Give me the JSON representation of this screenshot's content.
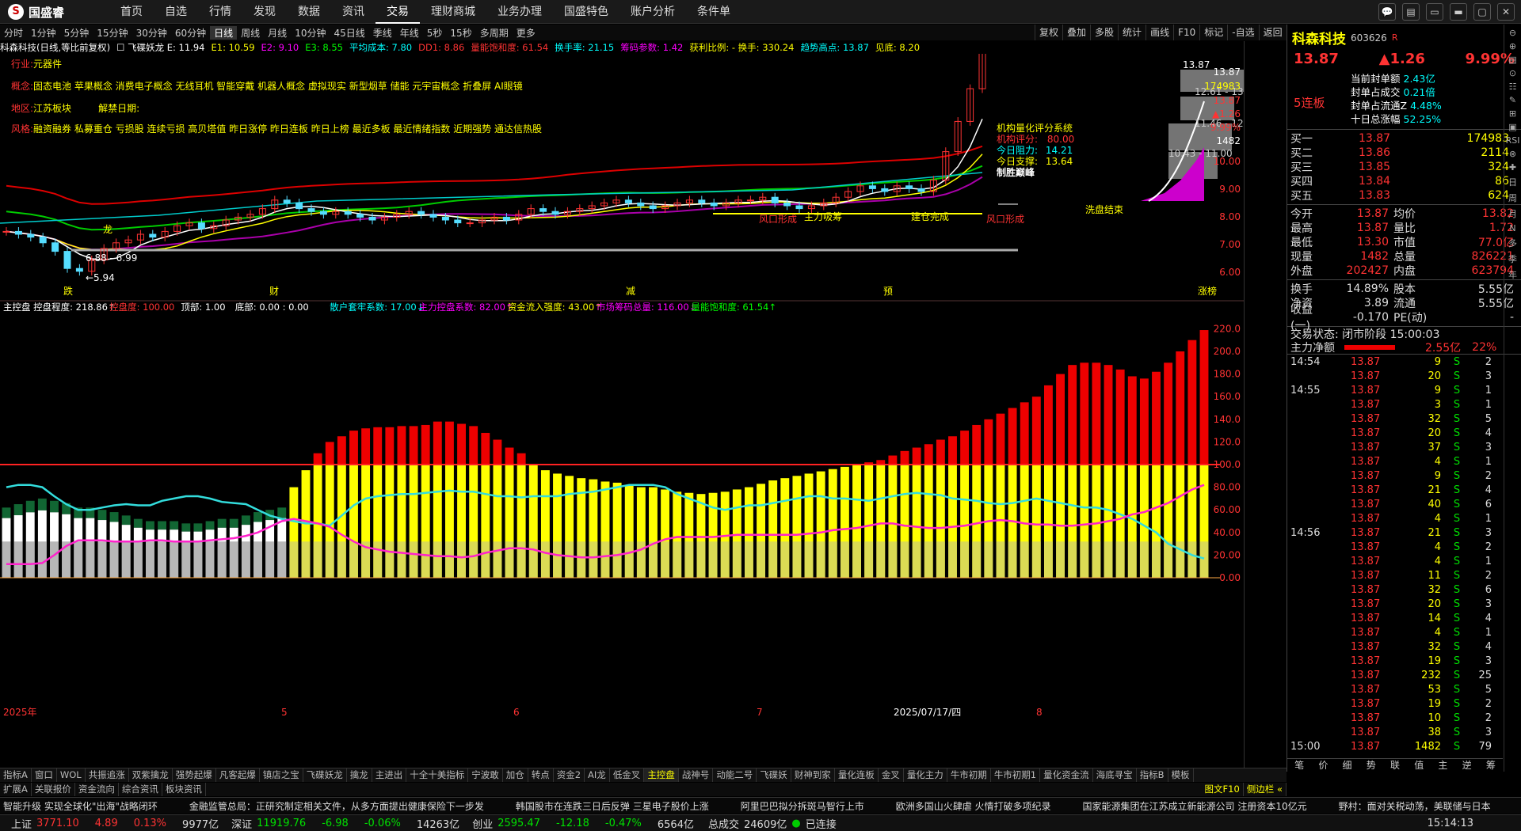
{
  "app": {
    "name": "国盛睿",
    "logo_char": "S"
  },
  "menu": [
    "首页",
    "自选",
    "行情",
    "发现",
    "数据",
    "资讯",
    "交易",
    "理财商城",
    "业务办理",
    "国盛特色",
    "账户分析",
    "条件单"
  ],
  "menu_active": 6,
  "window_buttons": [
    "💬",
    "▤",
    "▭",
    "▬",
    "▢",
    "✕"
  ],
  "periods": [
    "分时",
    "1分钟",
    "5分钟",
    "15分钟",
    "30分钟",
    "60分钟",
    "日线",
    "周线",
    "月线",
    "10分钟",
    "45日线",
    "季线",
    "年线",
    "5秒",
    "15秒",
    "多周期",
    "更多"
  ],
  "periods_active": 6,
  "tools": [
    "复权",
    "叠加",
    "多股",
    "统计",
    "画线",
    "F10",
    "标记",
    "-自选",
    "返回"
  ],
  "indicator_line": [
    {
      "t": "科森科技(日线,等比前复权)",
      "c": "#ffffff"
    },
    {
      "t": "☐ 飞碟妖龙 E: 11.94",
      "c": "#ffffff"
    },
    {
      "t": "E1: 10.59",
      "c": "#ffff00"
    },
    {
      "t": "E2: 9.10",
      "c": "#ff00ff"
    },
    {
      "t": "E3: 8.55",
      "c": "#00ff00"
    },
    {
      "t": "平均成本: 7.80",
      "c": "#00ffff"
    },
    {
      "t": "DD1: 8.86",
      "c": "#ff3333"
    },
    {
      "t": "量能饱和度: 61.54",
      "c": "#ff3333"
    },
    {
      "t": "换手率: 21.15",
      "c": "#00ffff"
    },
    {
      "t": "筹码参数: 1.42",
      "c": "#ff00ff"
    },
    {
      "t": "获利比例: - 换手: 330.24",
      "c": "#ffff00"
    },
    {
      "t": "趋势高点: 13.87",
      "c": "#00ffff"
    },
    {
      "t": "见底: 8.20",
      "c": "#ffff00"
    }
  ],
  "info": {
    "industry": {
      "k": "行业:",
      "v": "元器件"
    },
    "concept": {
      "k": "概念:",
      "v": "固态电池 苹果概念 消费电子概念 无线耳机 智能穿戴 机器人概念 虚拟现实 新型烟草 储能 元宇宙概念 折叠屏 AI眼镜"
    },
    "region": {
      "k": "地区:",
      "v": "江苏板块",
      "k2": "解禁日期:"
    },
    "style": {
      "k": "风格:",
      "v": "融资融券 私募重仓 亏损股 连续亏损 高贝塔值 昨日涨停 昨日连板 昨日上榜 最近多板 最近情绪指数 近期强势 通达信热股"
    }
  },
  "quant": {
    "title": "机构量化评分系统",
    "score_label": "机构评分:",
    "score": "80.00",
    "res_label": "今日阻力:",
    "res": "14.21",
    "sup_label": "今日支撑:",
    "sup": "13.64",
    "tag": "制胜巅峰"
  },
  "chart_data": [
    {
      "type": "candlestick",
      "y_ticks": [
        "13.87",
        "174983",
        "13.87",
        "▲1.26",
        "9.99%",
        "1482",
        "10.00",
        "9.00",
        "8.00",
        "7.00",
        "6.00"
      ],
      "annotations": [
        "13.87",
        "12.61 - 13.3",
        "11.46 - 12.61",
        "10.43 - 11.00",
        "6.88 - 6.99",
        "←5.94",
        "龙",
        "风口形成",
        "主力吸筹",
        "建仓完成",
        "洗盘结束",
        "风口形成",
        "跌",
        "财",
        "减",
        "预",
        "涨榜"
      ],
      "close_approx": [
        7.6,
        7.5,
        7.4,
        7.2,
        6.9,
        6.3,
        6.2,
        6.6,
        7.0,
        7.2,
        7.3,
        7.5,
        7.4,
        7.6,
        7.8,
        7.9,
        7.7,
        7.8,
        8.0,
        8.1,
        8.2,
        8.4,
        8.7,
        8.6,
        8.4,
        8.3,
        8.2,
        8.3,
        8.2,
        8.1,
        8.0,
        8.1,
        8.2,
        8.3,
        8.2,
        8.1,
        8.0,
        7.9,
        7.9,
        8.0,
        8.1,
        8.0,
        8.2,
        8.4,
        8.3,
        8.2,
        8.3,
        8.4,
        8.5,
        8.6,
        8.7,
        8.6,
        8.5,
        8.4,
        8.5,
        8.6,
        8.7,
        8.6,
        8.5,
        8.6,
        8.7,
        8.7,
        8.8,
        8.6,
        8.5,
        8.4,
        8.5,
        8.6,
        8.8,
        9.0,
        9.2,
        9.1,
        9.0,
        9.2,
        9.1,
        9.0,
        9.4,
        10.4,
        11.46,
        12.61,
        13.87
      ]
    },
    {
      "type": "bar",
      "title": "主控盘",
      "legend": [
        {
          "t": "主控盘 控盘程度: 218.86↑",
          "c": "#ffffff"
        },
        {
          "t": "控盘度: 100.00",
          "c": "#ff3333"
        },
        {
          "t": "顶部: 1.00",
          "c": "#ffffff"
        },
        {
          "t": "底部: 0.00 : 0.00",
          "c": "#ffffff"
        },
        {
          "t": "散户套牢系数: 17.00↓",
          "c": "#00ffff"
        },
        {
          "t": "主力控盘系数: 82.00↑",
          "c": "#ff00ff"
        },
        {
          "t": "资金流入强度: 43.00↑",
          "c": "#ffff00"
        },
        {
          "t": "市场筹码总量: 116.00↓",
          "c": "#ff00ff"
        },
        {
          "t": "量能饱和度: 61.54↑",
          "c": "#00ff00"
        }
      ],
      "y_ticks": [
        "220.0",
        "200.0",
        "180.0",
        "160.0",
        "140.0",
        "120.0",
        "100.0",
        "80.00",
        "60.00",
        "40.00",
        "20.00",
        "0.00"
      ],
      "x_labels": [
        "2025年",
        "5",
        "6",
        "7",
        "2025/07/17/四",
        "8"
      ],
      "values": [
        62,
        65,
        68,
        70,
        68,
        66,
        62,
        62,
        60,
        58,
        55,
        52,
        50,
        50,
        50,
        48,
        48,
        50,
        52,
        52,
        55,
        58,
        60,
        62,
        80,
        95,
        110,
        120,
        125,
        130,
        132,
        133,
        133,
        134,
        134,
        135,
        138,
        138,
        136,
        134,
        128,
        122,
        115,
        110,
        100,
        95,
        92,
        90,
        88,
        87,
        85,
        84,
        82,
        80,
        80,
        78,
        76,
        75,
        74,
        75,
        76,
        78,
        80,
        83,
        86,
        88,
        90,
        92,
        94,
        96,
        98,
        100,
        102,
        104,
        108,
        112,
        115,
        118,
        122,
        125,
        130,
        135,
        140,
        145,
        150,
        155,
        160,
        170,
        180,
        188,
        190,
        190,
        188,
        184,
        178,
        176,
        182,
        190,
        200,
        210,
        218.86
      ],
      "cyan_line": [
        80,
        82,
        82,
        80,
        72,
        65,
        60,
        60,
        62,
        64,
        65,
        64,
        64,
        68,
        70,
        72,
        72,
        70,
        67,
        66,
        65,
        60,
        55,
        52,
        50,
        48,
        48,
        46,
        55,
        64,
        70,
        72,
        73,
        74,
        74,
        75,
        76,
        77,
        76,
        76,
        74,
        72,
        72,
        71,
        72,
        72,
        72,
        74,
        75,
        76,
        78,
        80,
        82,
        82,
        82,
        80,
        74,
        70,
        66,
        62,
        60,
        62,
        64,
        64,
        66,
        68,
        70,
        72,
        72,
        70,
        70,
        69,
        68,
        70,
        72,
        74,
        75,
        74,
        73,
        70,
        69,
        68,
        66,
        65,
        66,
        68,
        70,
        68,
        66,
        64,
        62,
        62,
        60,
        56,
        52,
        46,
        40,
        30,
        25,
        20,
        17
      ],
      "magenta_line": [
        12,
        12,
        12,
        13,
        20,
        28,
        33,
        33,
        33,
        32,
        32,
        32,
        33,
        33,
        32,
        32,
        32,
        33,
        34,
        35,
        37,
        40,
        45,
        50,
        52,
        50,
        48,
        45,
        38,
        32,
        27,
        25,
        23,
        22,
        21,
        20,
        19,
        19,
        18,
        19,
        22,
        24,
        26,
        26,
        25,
        22,
        20,
        19,
        18,
        18,
        19,
        20,
        22,
        25,
        30,
        34,
        36,
        36,
        36,
        36,
        37,
        38,
        38,
        38,
        38,
        38,
        38,
        39,
        40,
        42,
        43,
        44,
        46,
        48,
        48,
        46,
        45,
        44,
        44,
        45,
        46,
        48,
        50,
        51,
        50,
        48,
        47,
        47,
        46,
        46,
        47,
        48,
        50,
        52,
        56,
        58,
        62,
        66,
        72,
        78,
        82
      ]
    }
  ],
  "sidepanel_right_tools": [
    "⊖",
    "⊕",
    "▤",
    "⊙",
    "☷",
    "✎",
    "⊞",
    "▣",
    "RSI",
    "⊗",
    "✚",
    "日",
    "周",
    "月",
    "N",
    "多",
    "季",
    "年"
  ],
  "quote": {
    "name": "科森科技",
    "code": "603626",
    "r": "R",
    "price": "13.87",
    "change": "▲1.26",
    "pct": "9.99%",
    "limit_board": "5连板",
    "limit_rows": [
      {
        "k": "当前封单额",
        "v": "2.43亿"
      },
      {
        "k": "封单占成交",
        "v": "0.21倍"
      },
      {
        "k": "封单占流通Z",
        "v": "4.48%"
      },
      {
        "k": "十日总涨幅",
        "v": "52.25%"
      }
    ],
    "bids": [
      {
        "k": "买一",
        "p": "13.87",
        "v": "174983"
      },
      {
        "k": "买二",
        "p": "13.86",
        "v": "2114"
      },
      {
        "k": "买三",
        "p": "13.85",
        "v": "324"
      },
      {
        "k": "买四",
        "p": "13.84",
        "v": "86"
      },
      {
        "k": "买五",
        "p": "13.83",
        "v": "624"
      }
    ],
    "stats": [
      {
        "k1": "今开",
        "v1": "13.87",
        "k2": "均价",
        "v2": "13.82"
      },
      {
        "k1": "最高",
        "v1": "13.87",
        "k2": "量比",
        "v2": "1.72"
      },
      {
        "k1": "最低",
        "v1": "13.30",
        "k2": "市值",
        "v2": "77.0亿"
      },
      {
        "k1": "现量",
        "v1": "1482",
        "k2": "总量",
        "v2": "826221"
      },
      {
        "k1": "外盘",
        "v1": "202427",
        "k2": "内盘",
        "v2": "623794"
      }
    ],
    "stats2": [
      {
        "k1": "换手",
        "v1": "14.89%",
        "k2": "股本",
        "v2": "5.55亿"
      },
      {
        "k1": "净资",
        "v1": "3.89",
        "k2": "流通",
        "v2": "5.55亿"
      },
      {
        "k1": "收益(一)",
        "v1": "-0.170",
        "k2": "PE(动)",
        "v2": "-"
      }
    ],
    "state": "交易状态: 闭市阶段 15:00:03",
    "netflow_label": "主力净额",
    "netflow": "2.55亿",
    "netflow_pct": "22%",
    "ticks": [
      {
        "t": "14:54",
        "p": "13.87",
        "v": "9",
        "s": "S",
        "n": "2"
      },
      {
        "t": "",
        "p": "13.87",
        "v": "20",
        "s": "S",
        "n": "3"
      },
      {
        "t": "14:55",
        "p": "13.87",
        "v": "9",
        "s": "S",
        "n": "1"
      },
      {
        "t": "",
        "p": "13.87",
        "v": "3",
        "s": "S",
        "n": "1"
      },
      {
        "t": "",
        "p": "13.87",
        "v": "32",
        "s": "S",
        "n": "5"
      },
      {
        "t": "",
        "p": "13.87",
        "v": "20",
        "s": "S",
        "n": "4"
      },
      {
        "t": "",
        "p": "13.87",
        "v": "37",
        "s": "S",
        "n": "3"
      },
      {
        "t": "",
        "p": "13.87",
        "v": "4",
        "s": "S",
        "n": "1"
      },
      {
        "t": "",
        "p": "13.87",
        "v": "9",
        "s": "S",
        "n": "2"
      },
      {
        "t": "",
        "p": "13.87",
        "v": "21",
        "s": "S",
        "n": "4"
      },
      {
        "t": "",
        "p": "13.87",
        "v": "40",
        "s": "S",
        "n": "6"
      },
      {
        "t": "",
        "p": "13.87",
        "v": "4",
        "s": "S",
        "n": "1"
      },
      {
        "t": "14:56",
        "p": "13.87",
        "v": "21",
        "s": "S",
        "n": "3"
      },
      {
        "t": "",
        "p": "13.87",
        "v": "4",
        "s": "S",
        "n": "2"
      },
      {
        "t": "",
        "p": "13.87",
        "v": "4",
        "s": "S",
        "n": "1"
      },
      {
        "t": "",
        "p": "13.87",
        "v": "11",
        "s": "S",
        "n": "2"
      },
      {
        "t": "",
        "p": "13.87",
        "v": "32",
        "s": "S",
        "n": "6"
      },
      {
        "t": "",
        "p": "13.87",
        "v": "20",
        "s": "S",
        "n": "3"
      },
      {
        "t": "",
        "p": "13.87",
        "v": "14",
        "s": "S",
        "n": "4"
      },
      {
        "t": "",
        "p": "13.87",
        "v": "4",
        "s": "S",
        "n": "1"
      },
      {
        "t": "",
        "p": "13.87",
        "v": "32",
        "s": "S",
        "n": "4"
      },
      {
        "t": "",
        "p": "13.87",
        "v": "19",
        "s": "S",
        "n": "3"
      },
      {
        "t": "",
        "p": "13.87",
        "v": "232",
        "s": "S",
        "n": "25"
      },
      {
        "t": "",
        "p": "13.87",
        "v": "53",
        "s": "S",
        "n": "5"
      },
      {
        "t": "",
        "p": "13.87",
        "v": "19",
        "s": "S",
        "n": "2"
      },
      {
        "t": "",
        "p": "13.87",
        "v": "10",
        "s": "S",
        "n": "2"
      },
      {
        "t": "",
        "p": "13.87",
        "v": "38",
        "s": "S",
        "n": "3"
      },
      {
        "t": "15:00",
        "p": "13.87",
        "v": "1482",
        "s": "S",
        "n": "79"
      }
    ],
    "bottom_tabs": [
      "笔",
      "价",
      "细",
      "势",
      "联",
      "值",
      "主",
      "逆",
      "筹"
    ]
  },
  "tabs1": [
    "指标A",
    "窗口",
    "WOL",
    "共振追涨",
    "双紫擒龙",
    "强势起爆",
    "凡客起爆",
    "镇店之宝",
    "飞碟妖龙",
    "擒龙",
    "主进出",
    "十全十美指标",
    "宁波敢",
    "加仓",
    "转点",
    "资金2",
    "AI龙",
    "低金叉",
    "主控盘",
    "战神号",
    "动能二号",
    "飞碟妖",
    "财神到家",
    "量化连板",
    "金叉",
    "量化主力",
    "牛市初期",
    "牛市初期1",
    "量化资金流",
    "海底寻宝",
    "指标B",
    "模板"
  ],
  "tabs1_active": 18,
  "tabs2": [
    "扩展A",
    "关联报价",
    "资金流向",
    "综合资讯",
    "板块资讯"
  ],
  "tabs2_right": [
    "图文F10",
    "侧边栏 «"
  ],
  "period_label": "日线",
  "news": [
    "智能升级 实现全球化\"出海\"战略闭环",
    "金融监管总局：正研究制定相关文件，从多方面提出健康保险下一步发",
    "韩国股市在连跌三日后反弹 三星电子股价上涨",
    "阿里巴巴拟分拆斑马智行上市",
    "欧洲多国山火肆虐 火情打破多项纪录",
    "国家能源集团在江苏成立新能源公司 注册资本10亿元",
    "野村：面对关税动荡，美联储与日本"
  ],
  "status": [
    {
      "k": "上证",
      "v": "3771.10",
      "c": "4.89",
      "p": "0.13%",
      "a": "9977亿"
    },
    {
      "k": "深证",
      "v": "11919.76",
      "c": "-6.98",
      "p": "-0.06%",
      "a": "14263亿"
    },
    {
      "k": "创业",
      "v": "2595.47",
      "c": "-12.18",
      "p": "-0.47%",
      "a": "6564亿"
    }
  ],
  "total_label": "总成交",
  "total": "24609亿",
  "conn": "已连接",
  "clock": "15:14:13"
}
